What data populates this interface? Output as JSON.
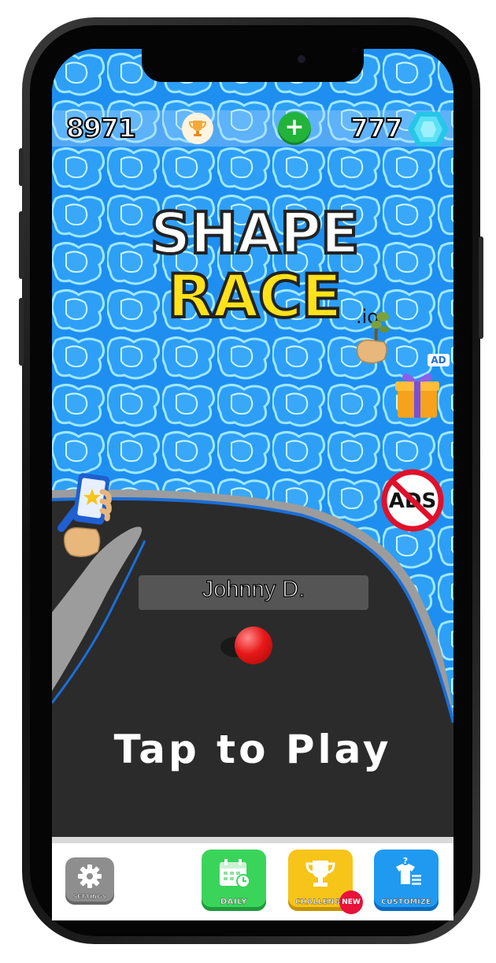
{
  "hud": {
    "coins": "8971",
    "gems": "777",
    "add_label": "+",
    "trophy_icon": "trophy-icon",
    "gem_icon": "diamond-icon"
  },
  "title": {
    "line1": "SHAPE",
    "line2": "RACE",
    "suffix": ".io"
  },
  "side": {
    "ad_badge": "AD",
    "no_ads_label": "ADS"
  },
  "game": {
    "player_name": "Johnny D.",
    "prompt": "Tap to Play"
  },
  "bottom_nav": {
    "settings": "SETTINGS",
    "daily": "DAILY",
    "challenge": "CHALLENGE",
    "customize": "CUSTOMIZE",
    "new_badge": "NEW"
  },
  "colors": {
    "water": "#1e8ff0",
    "road": "#2b2b2b",
    "title_yellow": "#ffe21a",
    "daily_green": "#3bd45b",
    "challenge_yellow": "#f7c41a",
    "customize_blue": "#1f9af0",
    "settings_gray": "#8e8e8e"
  }
}
